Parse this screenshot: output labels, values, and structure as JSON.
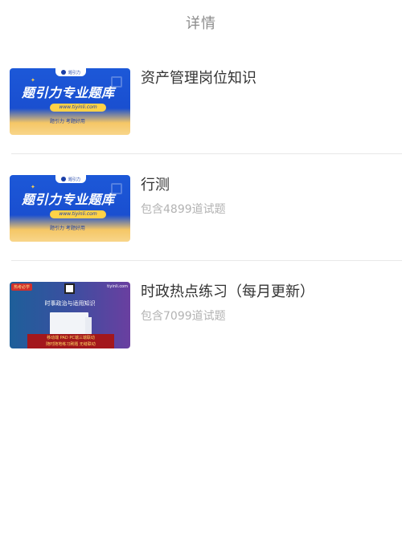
{
  "header": {
    "title": "详情"
  },
  "items": [
    {
      "title": "资产管理岗位知识",
      "subtitle": "",
      "thumb": {
        "style": "blue",
        "banner": "题引力专业题库",
        "url": "www.tiyinli.com",
        "slogan": "题引力 考题好用",
        "logo_text": "题引力"
      }
    },
    {
      "title": "行测",
      "subtitle": "包含4899道试题",
      "thumb": {
        "style": "blue",
        "banner": "题引力专业题库",
        "url": "www.tiyinli.com",
        "slogan": "题引力 考题好用",
        "logo_text": "题引力"
      }
    },
    {
      "title": "时政热点练习（每月更新）",
      "subtitle": "包含7099道试题",
      "thumb": {
        "style": "purple",
        "tag": "热考必学",
        "brand": "tiyinli.com",
        "headline": "时事政治与适用知识",
        "line1": "移动端 PAD PC端三端联动",
        "line2": "随时随地练习刷题 无缝联动"
      }
    }
  ],
  "colors": {
    "header_title": "#8c8c8c",
    "title": "#333333",
    "subtitle": "#b3b3b3",
    "divider": "#e8e8e8",
    "thumb_blue": "#1c58d8"
  }
}
